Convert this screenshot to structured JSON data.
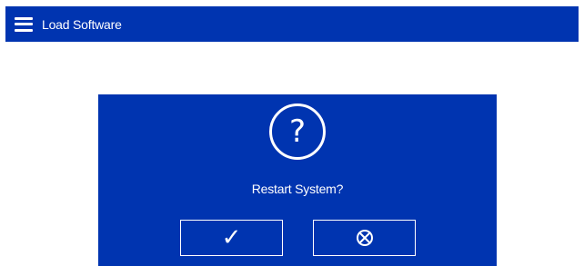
{
  "header": {
    "title": "Load Software",
    "menu_icon": "hamburger-menu-icon"
  },
  "dialog": {
    "icon": "question-circle-icon",
    "icon_glyph": "?",
    "message": "Restart System?",
    "confirm_icon": "checkmark-icon",
    "confirm_glyph": "✓",
    "cancel_icon": "circle-x-icon"
  },
  "colors": {
    "primary_blue": "#0034b0",
    "text": "#ffffff",
    "background": "#ffffff"
  }
}
